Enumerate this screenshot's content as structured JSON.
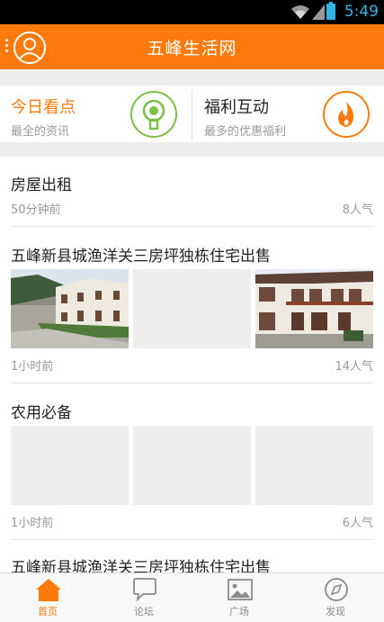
{
  "status_bar": {
    "time": "5:49"
  },
  "header": {
    "title": "五峰生活网"
  },
  "features": [
    {
      "title": "今日看点",
      "subtitle": "最全的资讯",
      "icon": "medal-icon"
    },
    {
      "title": "福利互动",
      "subtitle": "最多的优惠福利",
      "icon": "flame-icon"
    }
  ],
  "posts": [
    {
      "title": "房屋出租",
      "time": "50分钟前",
      "views": "8人气",
      "images": []
    },
    {
      "title": "五峰新县城渔洋关三房坪独栋住宅出售",
      "time": "1小时前",
      "views": "14人气",
      "images": [
        "house-photo",
        "placeholder",
        "house-photo"
      ]
    },
    {
      "title": "农用必备",
      "time": "1小时前",
      "views": "6人气",
      "images": [
        "placeholder",
        "placeholder",
        "placeholder"
      ]
    },
    {
      "title": "五峰新县城渔洋关三房坪独栋住宅出售"
    }
  ],
  "tabs": [
    {
      "label": "首页",
      "icon": "home-icon",
      "active": true
    },
    {
      "label": "论坛",
      "icon": "chat-bubble-icon",
      "active": false
    },
    {
      "label": "广场",
      "icon": "picture-icon",
      "active": false
    },
    {
      "label": "发现",
      "icon": "compass-icon",
      "active": false
    }
  ],
  "colors": {
    "accent": "#ff7a0c",
    "green": "#7ac143",
    "status_blue": "#33b5e5"
  }
}
